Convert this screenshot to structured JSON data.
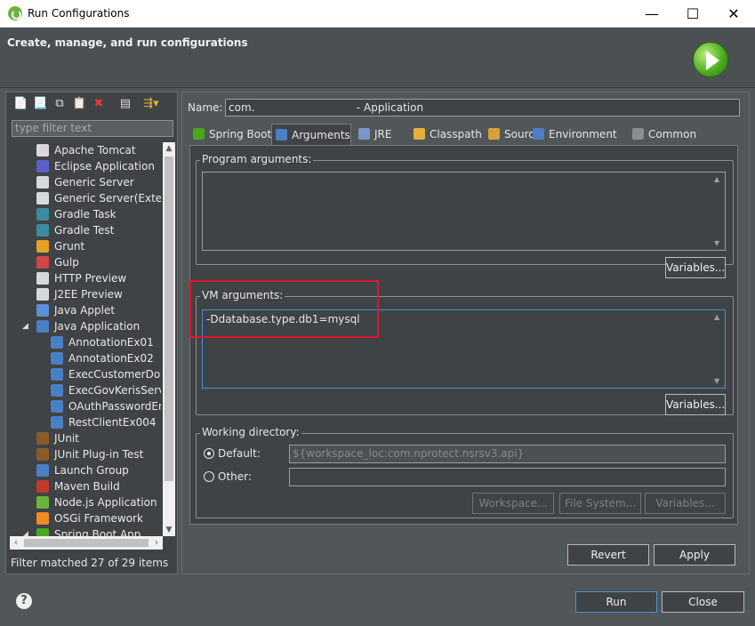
{
  "window": {
    "title": "Run Configurations",
    "minimize_glyph": "—",
    "maximize_glyph": "☐",
    "close_glyph": "✕"
  },
  "header": {
    "title": "Create, manage, and run configurations",
    "badge_icon": "run-icon"
  },
  "left": {
    "toolbar_icons": [
      "new-launch-configuration-icon",
      "new-prototype-icon",
      "duplicate-icon",
      "export-icon",
      "delete-icon",
      "collapse-all-icon",
      "filter-icon"
    ],
    "filter_placeholder": "type filter text",
    "tree": [
      {
        "label": "Apache Tomcat",
        "level": 0,
        "icon": "server-icon",
        "color": "#d8d8d8"
      },
      {
        "label": "Eclipse Application",
        "level": 0,
        "icon": "eclipse-icon",
        "color": "#5a5fc9"
      },
      {
        "label": "Generic Server",
        "level": 0,
        "icon": "server-icon",
        "color": "#d8d8d8"
      },
      {
        "label": "Generic Server(External",
        "level": 0,
        "icon": "server-icon",
        "color": "#d8d8d8"
      },
      {
        "label": "Gradle Task",
        "level": 0,
        "icon": "gradle-icon",
        "color": "#3b8a9e"
      },
      {
        "label": "Gradle Test",
        "level": 0,
        "icon": "gradle-icon",
        "color": "#3b8a9e"
      },
      {
        "label": "Grunt",
        "level": 0,
        "icon": "grunt-icon",
        "color": "#e4a125"
      },
      {
        "label": "Gulp",
        "level": 0,
        "icon": "gulp-icon",
        "color": "#cf4647"
      },
      {
        "label": "HTTP Preview",
        "level": 0,
        "icon": "server-icon",
        "color": "#d8d8d8"
      },
      {
        "label": "J2EE Preview",
        "level": 0,
        "icon": "server-icon",
        "color": "#d8d8d8"
      },
      {
        "label": "Java Applet",
        "level": 0,
        "icon": "applet-icon",
        "color": "#5b8fd6"
      },
      {
        "label": "Java Application",
        "level": 0,
        "icon": "java-app-icon",
        "color": "#4a7fc4",
        "expanded": true
      },
      {
        "label": "AnnotationEx01",
        "level": 1,
        "icon": "java-app-icon",
        "color": "#4a7fc4"
      },
      {
        "label": "AnnotationEx02",
        "level": 1,
        "icon": "java-app-icon",
        "color": "#4a7fc4"
      },
      {
        "label": "ExecCustomerDoma",
        "level": 1,
        "icon": "java-app-icon",
        "color": "#4a7fc4"
      },
      {
        "label": "ExecGovKerisService",
        "level": 1,
        "icon": "java-app-icon",
        "color": "#4a7fc4"
      },
      {
        "label": "OAuthPasswordEnco",
        "level": 1,
        "icon": "java-app-icon",
        "color": "#4a7fc4"
      },
      {
        "label": "RestClientEx004",
        "level": 1,
        "icon": "java-app-icon",
        "color": "#4a7fc4"
      },
      {
        "label": "JUnit",
        "level": 0,
        "icon": "junit-icon",
        "color": "#8a5a2b"
      },
      {
        "label": "JUnit Plug-in Test",
        "level": 0,
        "icon": "junit-icon",
        "color": "#8a5a2b"
      },
      {
        "label": "Launch Group",
        "level": 0,
        "icon": "launch-group-icon",
        "color": "#4a7fc4"
      },
      {
        "label": "Maven Build",
        "level": 0,
        "icon": "maven-icon",
        "color": "#c0392b"
      },
      {
        "label": "Node.js Application",
        "level": 0,
        "icon": "nodejs-icon",
        "color": "#6cb33e"
      },
      {
        "label": "OSGi Framework",
        "level": 0,
        "icon": "osgi-icon",
        "color": "#f08a24"
      },
      {
        "label": "Spring Boot App",
        "level": 0,
        "icon": "spring-boot-icon",
        "color": "#49a81d",
        "expanded": true
      }
    ],
    "filter_status": "Filter matched 27 of 29 items"
  },
  "right": {
    "name_label": "Name:",
    "name_value": "com.                              - Application",
    "tabs": [
      {
        "label": "Spring Boot",
        "icon": "spring-boot-icon",
        "color": "#49a81d"
      },
      {
        "label": "Arguments",
        "icon": "arguments-icon",
        "color": "#4a7fc4",
        "active": true
      },
      {
        "label": "JRE",
        "icon": "jre-icon",
        "color": "#7b95c9"
      },
      {
        "label": "Classpath",
        "icon": "classpath-icon",
        "color": "#e0b13c"
      },
      {
        "label": "Source",
        "icon": "source-icon",
        "color": "#d8a23a"
      },
      {
        "label": "Environment",
        "icon": "environment-icon",
        "color": "#4a7fc4"
      },
      {
        "label": "Common",
        "icon": "common-icon",
        "color": "#8a8e90"
      }
    ],
    "program_args": {
      "label": "Program arguments:",
      "value": "",
      "variables_button": "Variables..."
    },
    "vm_args": {
      "label": "VM arguments:",
      "value": "-Ddatabase.type.db1=mysql",
      "variables_button": "Variables..."
    },
    "working_dir": {
      "label": "Working directory:",
      "default_label": "Default:",
      "default_value": "${workspace_loc:com.nprotect.nsrsv3.api}",
      "other_label": "Other:",
      "other_value": "",
      "workspace_button": "Workspace...",
      "filesystem_button": "File System...",
      "variables_button": "Variables..."
    },
    "revert_button": "Revert",
    "apply_button": "Apply"
  },
  "footer": {
    "help_glyph": "?",
    "run_button": "Run",
    "close_button": "Close"
  },
  "colors": {
    "highlight": "#e0162b",
    "accent": "#4a90d9"
  }
}
